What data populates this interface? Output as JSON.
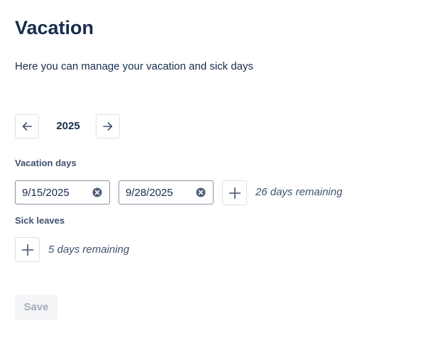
{
  "page": {
    "title": "Vacation",
    "subtitle": "Here you can manage your vacation and sick days"
  },
  "year_nav": {
    "year": "2025",
    "prev_icon": "arrow-left-icon",
    "next_icon": "arrow-right-icon"
  },
  "vacation": {
    "label": "Vacation days",
    "start_date": "9/15/2025",
    "end_date": "9/28/2025",
    "clear_icon": "clear-circle-icon",
    "add_icon": "plus-icon",
    "remaining": "26 days remaining"
  },
  "sick": {
    "label": "Sick leaves",
    "add_icon": "plus-icon",
    "remaining": "5 days remaining"
  },
  "actions": {
    "save_label": "Save",
    "save_disabled": true
  },
  "colors": {
    "text_primary": "#172b4d",
    "text_secondary": "#42526e",
    "border": "#dfe1e6",
    "input_border": "#8993a4",
    "disabled_bg": "#f4f5f7",
    "disabled_text": "#a5adba"
  }
}
